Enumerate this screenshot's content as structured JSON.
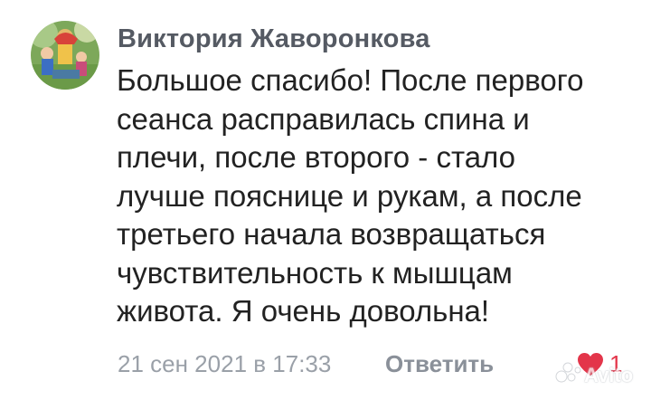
{
  "comment": {
    "author": "Виктория Жаворонкова",
    "lines": [
      "Большое спасибо! После первого",
      "сеанса расправилась спина и",
      "плечи, после второго - стало",
      "лучше пояснице и рукам, а после",
      "третьего начала возвращаться",
      "чувствительность к мышцам",
      "живота. Я очень довольна!"
    ],
    "date": "21 сен 2021 в 17:33",
    "reply_label": "Ответить",
    "like_count": "1",
    "liked": true
  },
  "watermark": {
    "text": "Avito"
  },
  "colors": {
    "author": "#555a63",
    "text": "#222222",
    "meta": "#9aa0a8",
    "reply": "#8a9099",
    "heart": "#e3354a"
  },
  "icons": {
    "avatar": "user-photo",
    "like": "heart-icon",
    "watermark": "avito-logo"
  }
}
